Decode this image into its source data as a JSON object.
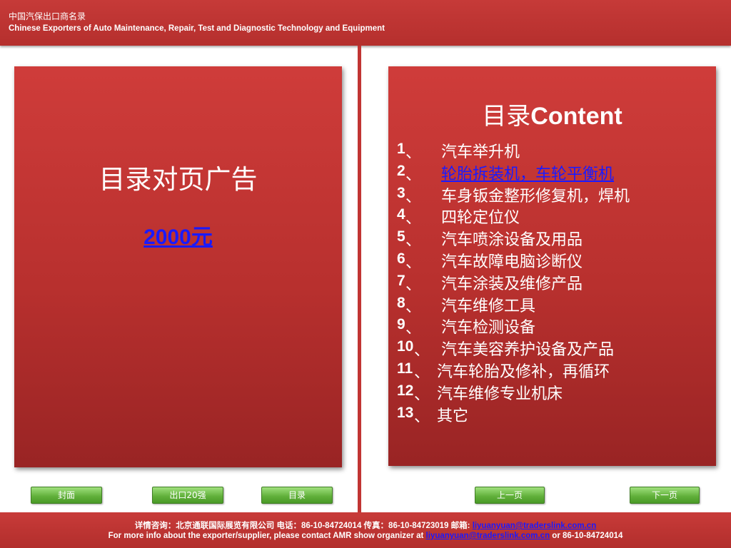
{
  "header": {
    "line1": "中国汽保出口商名录",
    "line2": "Chinese Exporters of Auto Maintenance, Repair, Test and Diagnostic Technology and Equipment"
  },
  "left_panel": {
    "title": "目录对页广告",
    "price": "2000元"
  },
  "right_panel": {
    "title_cn": "目录",
    "title_en": "Content",
    "items": [
      {
        "num": "1",
        "sep": "、",
        "label": "汽车举升机",
        "link": false
      },
      {
        "num": "2",
        "sep": "、",
        "label": "轮胎拆装机，车轮平衡机",
        "link": true
      },
      {
        "num": "3",
        "sep": "、",
        "label": "车身钣金整形修复机，焊机",
        "link": false
      },
      {
        "num": "4",
        "sep": "、",
        "label": "四轮定位仪",
        "link": false
      },
      {
        "num": "5",
        "sep": "、",
        "label": "汽车喷涂设备及用品",
        "link": false
      },
      {
        "num": "6",
        "sep": "、",
        "label": "汽车故障电脑诊断仪",
        "link": false
      },
      {
        "num": "7",
        "sep": "、",
        "label": "汽车涂装及维修产品",
        "link": false
      },
      {
        "num": "8",
        "sep": "、",
        "label": "汽车维修工具",
        "link": false
      },
      {
        "num": "9",
        "sep": "、",
        "label": "汽车检测设备",
        "link": false
      },
      {
        "num": "10",
        "sep": "、",
        "label": "汽车美容养护设备及产品",
        "link": false
      },
      {
        "num": "11",
        "sep": " 、",
        "label": "汽车轮胎及修补，再循环",
        "link": false
      },
      {
        "num": "12",
        "sep": " 、",
        "label": "汽车维修专业机床",
        "link": false
      },
      {
        "num": "13",
        "sep": " 、",
        "label": "其它",
        "link": false
      }
    ]
  },
  "nav": {
    "cover": "封面",
    "top20": "出口20强",
    "contents": "目录",
    "prev": "上一页",
    "next": "下一页"
  },
  "footer": {
    "line1_text": "详情咨询：北京通联国际展览有限公司  电话：86-10-84724014  传真：86-10-84723019 邮箱: ",
    "email": "liyuanyuan@traderslink.com.cn",
    "line2_pre": "For more info about the exporter/supplier, please contact AMR show organizer at ",
    "line2_post": " or 86-10-84724014"
  },
  "colors": {
    "brand_red": "#c63a38",
    "link_blue": "#1a1aff",
    "button_green": "#5fae38"
  }
}
